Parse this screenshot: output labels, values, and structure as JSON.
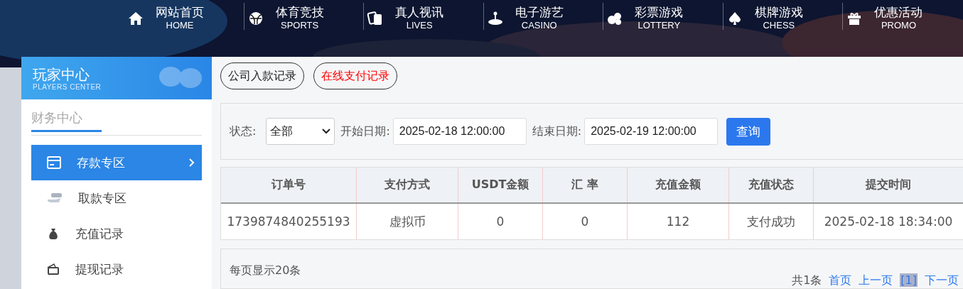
{
  "nav": [
    {
      "kind": "home",
      "label": "网站首页",
      "sub": "HOME"
    },
    {
      "kind": "sports",
      "label": "体育竞技",
      "sub": "SPORTS"
    },
    {
      "kind": "lives",
      "label": "真人视讯",
      "sub": "LIVES"
    },
    {
      "kind": "casino",
      "label": "电子游艺",
      "sub": "CASINO"
    },
    {
      "kind": "lottery",
      "label": "彩票游戏",
      "sub": "LOTTERY"
    },
    {
      "kind": "chess",
      "label": "棋牌游戏",
      "sub": "CHESS"
    },
    {
      "kind": "promo",
      "label": "优惠活动",
      "sub": "PROMO"
    }
  ],
  "sidebar": {
    "title": "玩家中心",
    "subtitle": "PLAYERS CENTER",
    "section": "财务中心",
    "items": [
      {
        "kind": "deposit",
        "label": "存款专区",
        "selected": true
      },
      {
        "kind": "withdraw",
        "label": "取款专区",
        "selected": false
      },
      {
        "kind": "recharge",
        "label": "充值记录",
        "selected": false
      },
      {
        "kind": "withdrawlog",
        "label": "提现记录",
        "selected": false
      }
    ]
  },
  "tabs": [
    {
      "label": "公司入款记录",
      "selected": false
    },
    {
      "label": "在线支付记录",
      "selected": true
    }
  ],
  "filter": {
    "status_label": "状态:",
    "status_value": "全部",
    "start_label": "开始日期:",
    "start_value": "2025-02-18 12:00:00",
    "end_label": "结束日期:",
    "end_value": "2025-02-19 12:00:00",
    "button": "查询"
  },
  "table": {
    "columns": [
      "订单号",
      "支付方式",
      "USDT金额",
      "汇 率",
      "充值金额",
      "充值状态",
      "提交时间"
    ],
    "rows": [
      [
        "1739874840255193",
        "虚拟币",
        "0",
        "0",
        "112",
        "支付成功",
        "2025-02-18 18:34:00"
      ]
    ]
  },
  "footer": {
    "per_page": "每页显示20条",
    "total": "共1条",
    "pages": [
      {
        "label": "首页",
        "selected": false
      },
      {
        "label": "上一页",
        "selected": false
      },
      {
        "label": "[1]",
        "selected": true
      },
      {
        "label": "下一页",
        "selected": false
      }
    ]
  }
}
